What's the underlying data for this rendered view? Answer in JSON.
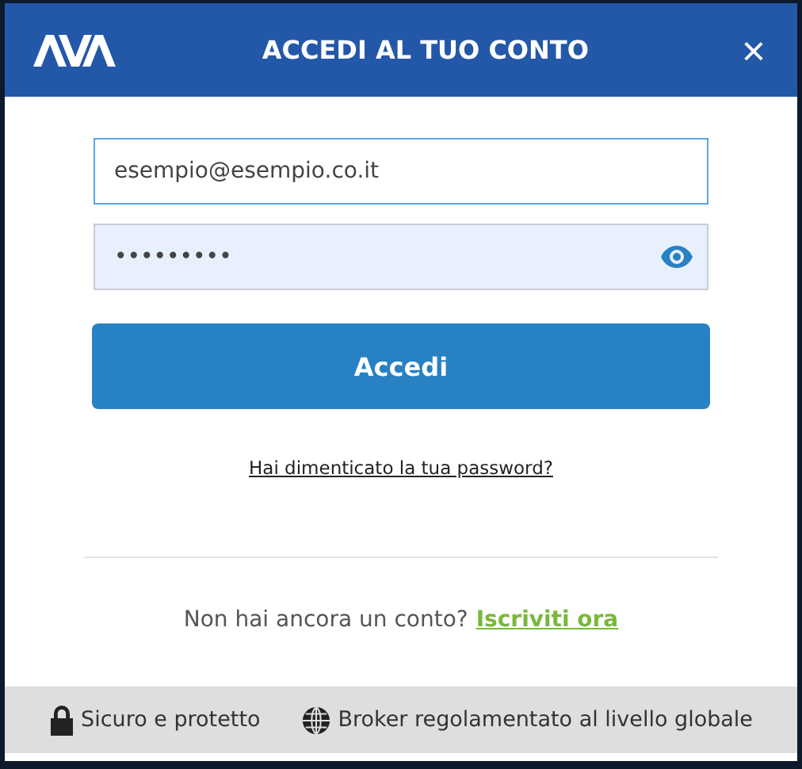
{
  "dialog": {
    "title": "ACCEDI AL TUO CONTO",
    "close": "×"
  },
  "email_field": {
    "value": "esempio@esempio.co.it",
    "focused": true
  },
  "password_field": {
    "value": "•••••••••"
  },
  "login_button": "Accedi",
  "forgot_link": "Hai dimenticato la tua password?",
  "signup": {
    "text": "Non hai ancora un conto?",
    "link": "Iscriviti ora"
  },
  "footer": [
    {
      "kind": "lock",
      "text": "Sicuro e protetto"
    },
    {
      "kind": "globe",
      "text": "Broker regolamentato al livello globale"
    }
  ]
}
